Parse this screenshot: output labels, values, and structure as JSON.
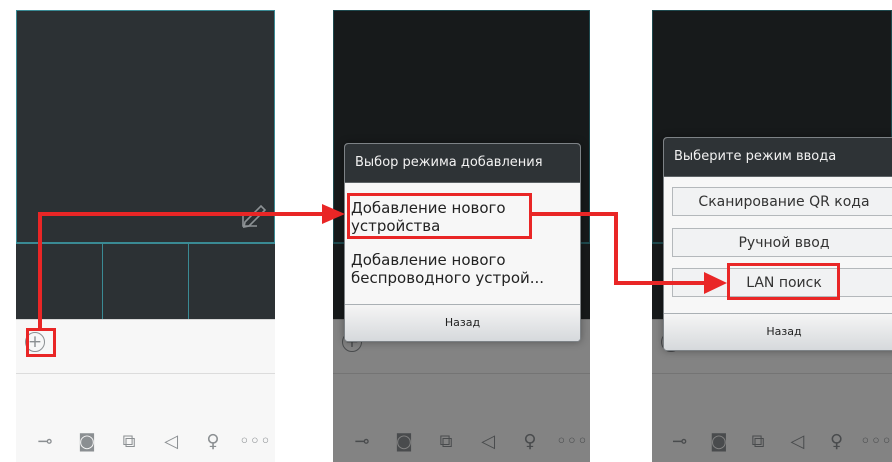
{
  "accent_color": "#e92626",
  "dialog_add_mode": {
    "title": "Выбор режима добавления",
    "options": [
      "Добавление нового устройства",
      "Добавление нового беспроводного устрой..."
    ],
    "back_label": "Назад"
  },
  "dialog_input_mode": {
    "title": "Выберите режим ввода",
    "options": [
      "Сканирование QR кода",
      "Ручной ввод",
      "LAN поиск"
    ],
    "back_label": "Назад"
  },
  "toolbar_icons": [
    "key-icon",
    "camera-icon",
    "video-record-icon",
    "speaker-icon",
    "microphone-icon",
    "more-icon"
  ]
}
